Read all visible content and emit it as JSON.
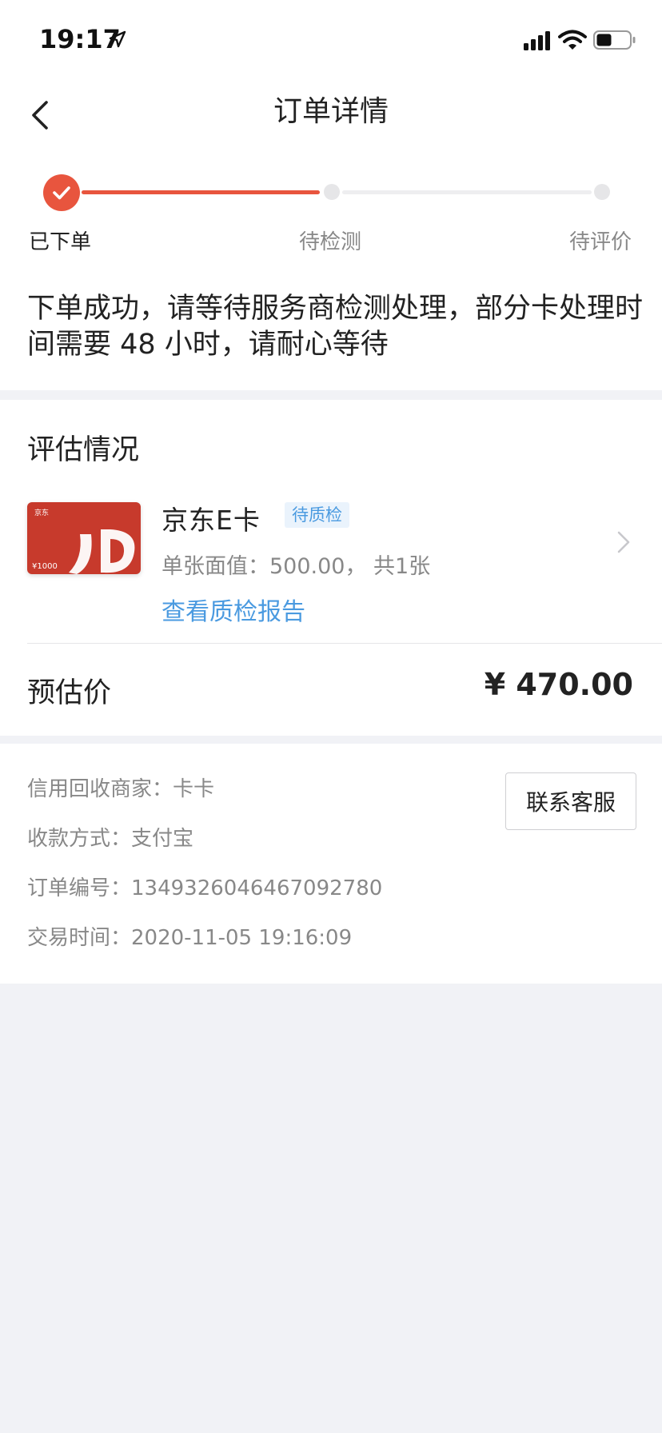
{
  "status_bar": {
    "time": "19:17",
    "icons": [
      "location-arrow-icon",
      "cellular-signal-icon",
      "wifi-icon",
      "battery-icon"
    ]
  },
  "nav": {
    "title": "订单详情",
    "back_icon": "chevron-left-icon"
  },
  "progress": {
    "steps": [
      {
        "label": "已下单",
        "state": "done"
      },
      {
        "label": "待检测",
        "state": "pending"
      },
      {
        "label": "待评价",
        "state": "pending"
      }
    ],
    "message": "下单成功，请等待服务商检测处理，部分卡处理时间需要 48 小时，请耐心等待"
  },
  "evaluation": {
    "title": "评估情况",
    "product": {
      "name": "京东E卡",
      "badge": "待质检",
      "face_value": "单张面值：500.00， 共1张",
      "report_link": "查看质检报告",
      "card_image": {
        "brand": "京东",
        "mark": "JD",
        "value": "¥1000"
      }
    },
    "price_label": "预估价",
    "price_value": "¥ 470.00"
  },
  "order_info": {
    "merchant": "信用回收商家：卡卡",
    "payment": "收款方式：支付宝",
    "order_no": "订单编号：1349326046467092780",
    "trade_time": "交易时间：2020-11-05 19:16:09",
    "contact_button": "联系客服"
  },
  "colors": {
    "accent": "#e8553e",
    "link": "#4a9ae0",
    "background": "#f1f2f6"
  }
}
